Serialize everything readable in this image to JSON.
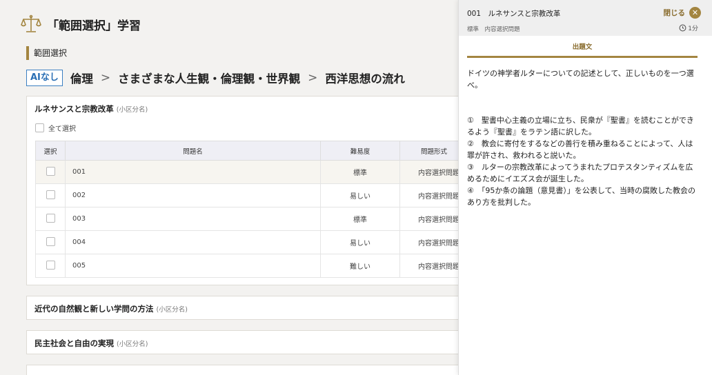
{
  "header": {
    "title": "「範囲選択」学習",
    "logo_icon": "scales-icon"
  },
  "section_label": "範囲選択",
  "breadcrumb": {
    "badge": "AIなし",
    "items": [
      "倫理",
      "さまざまな人生観・倫理観・世界観",
      "西洋思想の流れ"
    ],
    "separator": ">"
  },
  "sections": [
    {
      "title": "ルネサンスと宗教改革",
      "sub": "(小区分名)",
      "select_all": "全て選択",
      "columns": [
        "選択",
        "問題名",
        "難易度",
        "問題形式"
      ],
      "rows": [
        {
          "name": "001",
          "difficulty": "標準",
          "type": "内容選択問題"
        },
        {
          "name": "002",
          "difficulty": "易しい",
          "type": "内容選択問題"
        },
        {
          "name": "003",
          "difficulty": "標準",
          "type": "内容選択問題"
        },
        {
          "name": "004",
          "difficulty": "易しい",
          "type": "内容選択問題"
        },
        {
          "name": "005",
          "difficulty": "難しい",
          "type": "内容選択問題"
        }
      ]
    },
    {
      "title": "近代の自然観と新しい学問の方法",
      "sub": "(小区分名)"
    },
    {
      "title": "民主社会と自由の実現",
      "sub": "(小区分名)"
    }
  ],
  "panel": {
    "question_title": "001　ルネサンスと宗教改革",
    "meta": "標準　内容選択問題",
    "close_label": "閉じる",
    "time": "1分",
    "tab": "出題文",
    "question": "ドイツの神学者ルターについての記述として、正しいものを一つ選べ。",
    "choices": [
      "①　聖書中心主義の立場に立ち、民衆が『聖書』を読むことができるよう『聖書』をラテン語に訳した。",
      "②　教会に寄付をするなどの善行を積み重ねることによって、人は罪が許され、救われると説いた。",
      "③　ルターの宗教改革によってうまれたプロテスタンティズムを広めるためにイエズス会が誕生した。",
      "④　「95か条の論題（意見書）」を公表して、当時の腐敗した教会のあり方を批判した。"
    ]
  },
  "colors": {
    "accent": "#a38540",
    "ai_badge": "#2a6fb5",
    "table_header": "#efeff5"
  }
}
